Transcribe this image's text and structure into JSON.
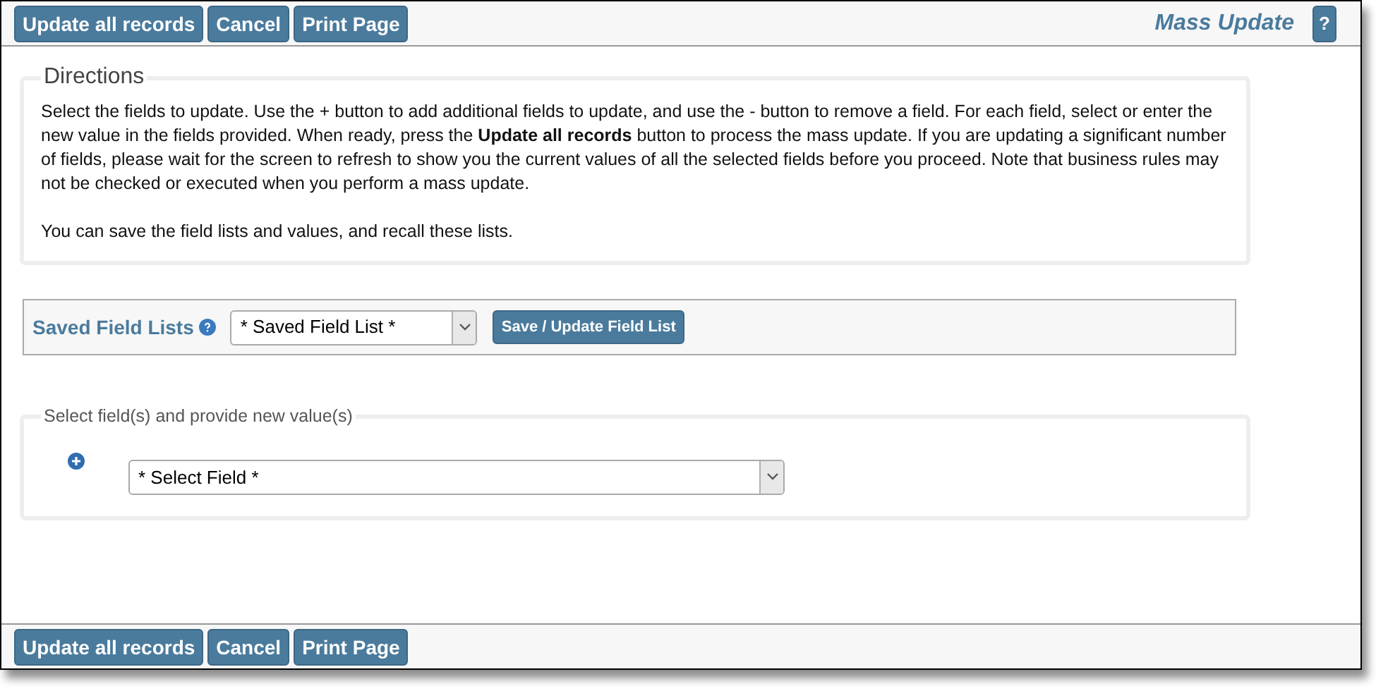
{
  "toolbar_top": {
    "buttons": [
      "Update all records",
      "Cancel",
      "Print Page"
    ],
    "title": "Mass Update",
    "help_button": "?"
  },
  "directions": {
    "legend": "Directions",
    "paragraphs": [
      "Select the fields to update. Use the + button to add additional fields to update, and use the - button to remove a field. For each field, select or enter the new value in the fields provided. When ready, press the **Update all records** button to process the mass update. If you are updating a significant number of fields, please wait for the screen to refresh to show you the current values of all the selected fields before you proceed. Note that business rules may not be checked or executed when you perform a mass update.",
      "You can save the field lists and values, and recall these lists."
    ]
  },
  "saved_field_lists": {
    "label": "Saved Field Lists",
    "select_value": "* Saved Field List *",
    "button": "Save / Update Field List"
  },
  "field_selection": {
    "legend": "Select field(s) and provide new value(s)",
    "select_value": "* Select Field *"
  },
  "toolbar_bottom": {
    "buttons": [
      "Update all records",
      "Cancel",
      "Print Page"
    ]
  }
}
